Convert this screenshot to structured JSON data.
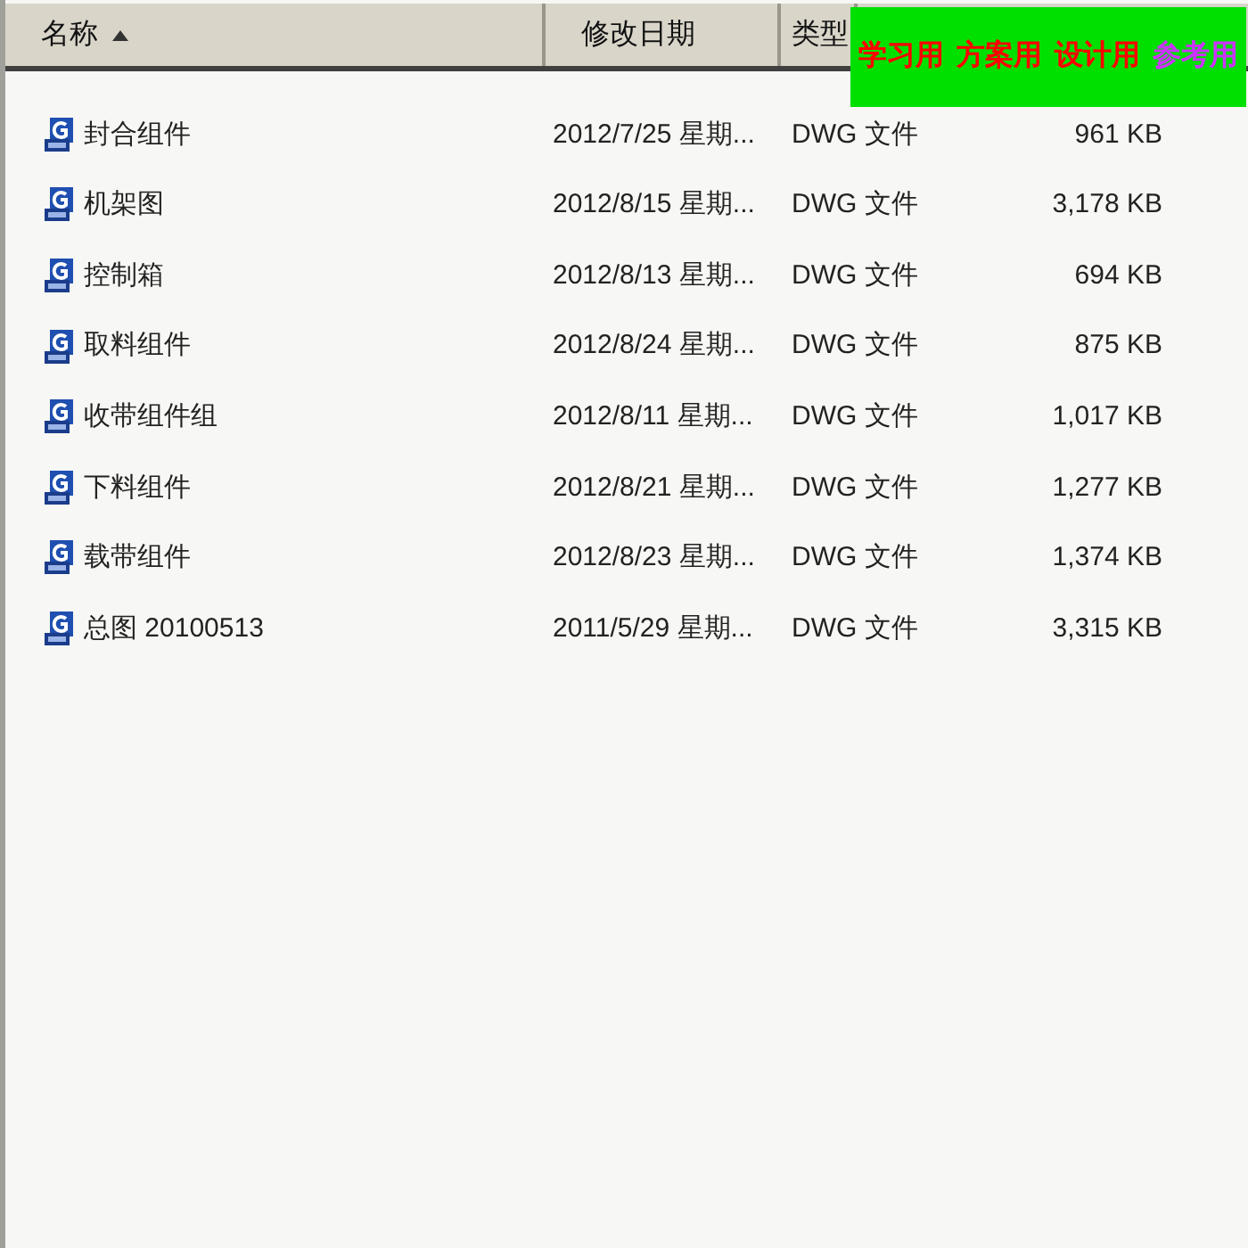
{
  "table": {
    "columns": [
      {
        "label": "名称",
        "sorted": true
      },
      {
        "label": "修改日期",
        "sorted": false
      },
      {
        "label": "类型",
        "sorted": false
      }
    ],
    "rows": [
      {
        "name": "封合组件",
        "modified": "2012/7/25 星期...",
        "type": "DWG 文件",
        "size": "961 KB"
      },
      {
        "name": "机架图",
        "modified": "2012/8/15 星期...",
        "type": "DWG 文件",
        "size": "3,178 KB"
      },
      {
        "name": "控制箱",
        "modified": "2012/8/13 星期...",
        "type": "DWG 文件",
        "size": "694 KB"
      },
      {
        "name": "取料组件",
        "modified": "2012/8/24 星期...",
        "type": "DWG 文件",
        "size": "875 KB"
      },
      {
        "name": "收带组件组",
        "modified": "2012/8/11 星期...",
        "type": "DWG 文件",
        "size": "1,017 KB"
      },
      {
        "name": "下料组件",
        "modified": "2012/8/21 星期...",
        "type": "DWG 文件",
        "size": "1,277 KB"
      },
      {
        "name": "载带组件",
        "modified": "2012/8/23 星期...",
        "type": "DWG 文件",
        "size": "1,374 KB"
      },
      {
        "name": "总图 20100513",
        "modified": "2011/5/29 星期...",
        "type": "DWG 文件",
        "size": "3,315 KB"
      }
    ]
  },
  "banner": {
    "labels": [
      {
        "text": "学习用",
        "color": "#ff0000"
      },
      {
        "text": "方案用",
        "color": "#ff0000"
      },
      {
        "text": "设计用",
        "color": "#ff0000"
      },
      {
        "text": "参考用",
        "color": "#cc33ff"
      }
    ]
  }
}
